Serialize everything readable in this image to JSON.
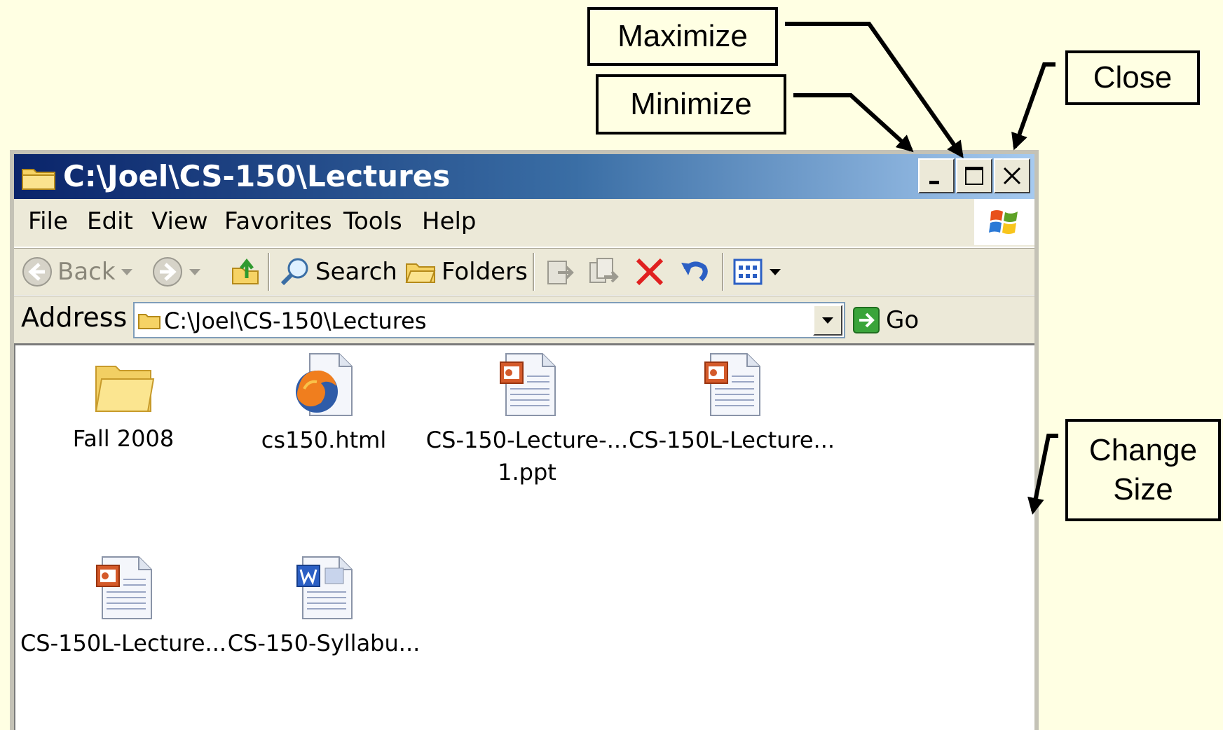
{
  "annotations": {
    "maximize": "Maximize",
    "minimize": "Minimize",
    "close": "Close",
    "change_size": "Change\nSize"
  },
  "window": {
    "title": "C:\\Joel\\CS-150\\Lectures",
    "menu": [
      "File",
      "Edit",
      "View",
      "Favorites",
      "Tools",
      "Help"
    ],
    "toolbar": {
      "back": "Back",
      "search": "Search",
      "folders": "Folders"
    },
    "address": {
      "label": "Address",
      "value": "C:\\Joel\\CS-150\\Lectures",
      "go": "Go"
    },
    "files": [
      {
        "name": "Fall 2008",
        "type": "folder"
      },
      {
        "name": "cs150.html",
        "type": "html"
      },
      {
        "name": "CS-150-Lecture-...\n1.ppt",
        "type": "ppt"
      },
      {
        "name": "CS-150L-Lecture...",
        "type": "ppt"
      },
      {
        "name": "CS-150L-Lecture...",
        "type": "ppt"
      },
      {
        "name": "CS-150-Syllabu...",
        "type": "doc"
      }
    ]
  },
  "colors": {
    "background": "#ffffe3",
    "titlebar_start": "#0a246a",
    "titlebar_end": "#a6caf0",
    "window_chrome": "#ece9d8",
    "close_x_red": "#e02020"
  }
}
